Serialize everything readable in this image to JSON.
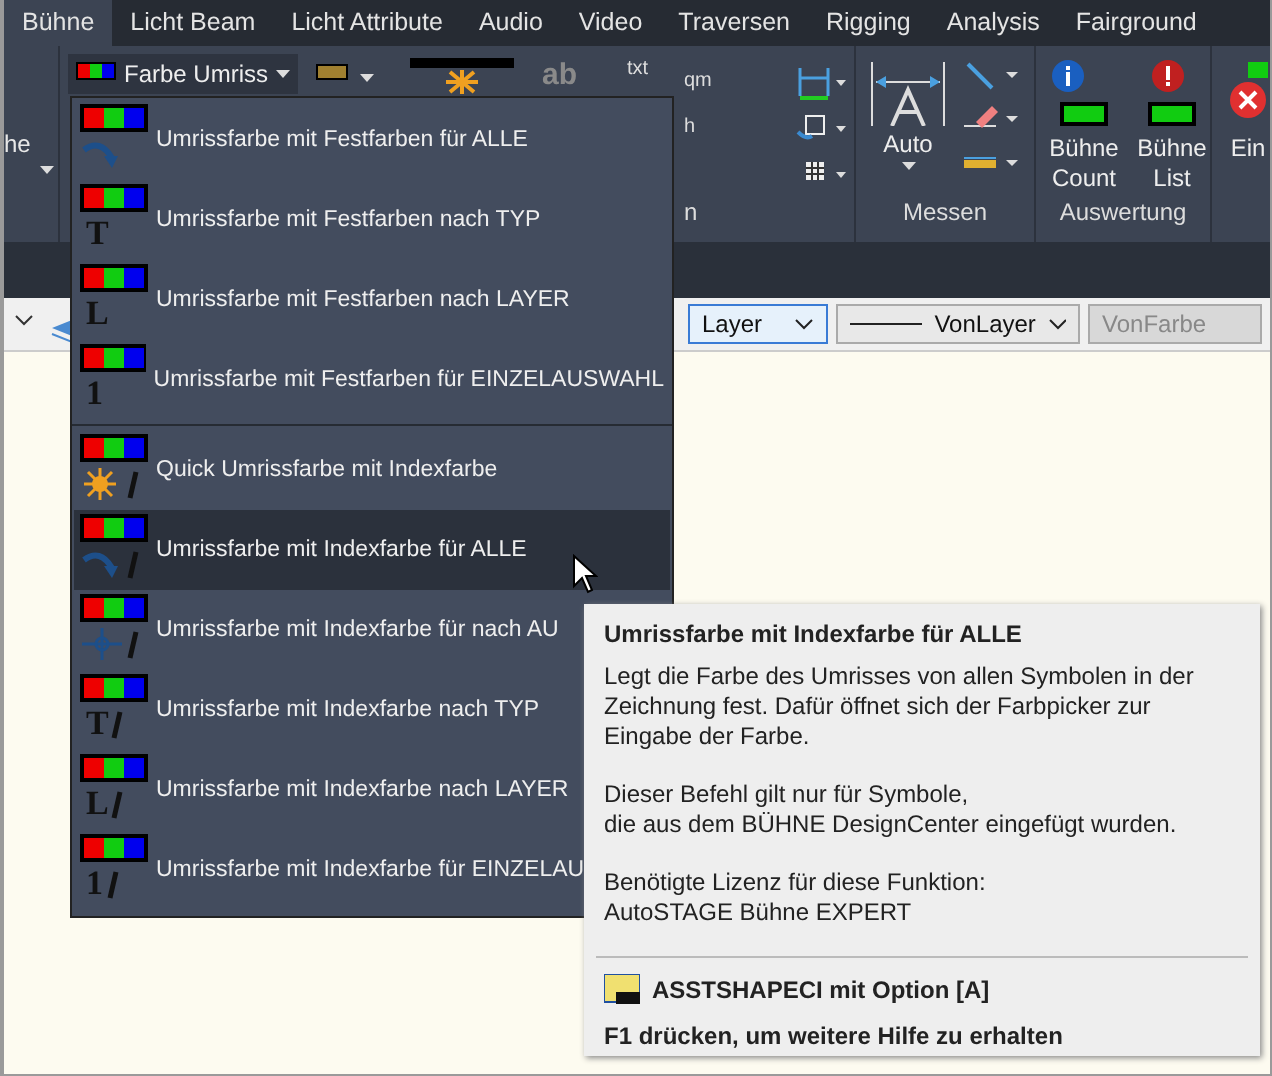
{
  "tabs": [
    {
      "label": "Bühne",
      "selected": true
    },
    {
      "label": "Licht Beam",
      "selected": false
    },
    {
      "label": "Licht Attribute",
      "selected": false
    },
    {
      "label": "Audio",
      "selected": false
    },
    {
      "label": "Video",
      "selected": false
    },
    {
      "label": "Traversen",
      "selected": false
    },
    {
      "label": "Rigging",
      "selected": false
    },
    {
      "label": "Analysis",
      "selected": false
    },
    {
      "label": "Fairground",
      "selected": false
    }
  ],
  "ribbon": {
    "cut_label": "he",
    "split_button": "Farbe Umriss",
    "icon_texts": [
      "ab",
      "txt",
      "qm",
      "h"
    ],
    "panel_labels": [
      "n",
      "Messen",
      "Auswertung"
    ],
    "auto_button": "Auto",
    "count_button": "Bühne Count",
    "list_button": "Bühne List",
    "cut_button": "Ein"
  },
  "toolbar": {
    "layer_combo": "Layer",
    "linetype_combo": "VonLayer",
    "color_combo": {
      "value": "VonFarbe",
      "disabled": true
    }
  },
  "menu": {
    "items": [
      {
        "label": "Umrissfarbe mit Festfarben für ALLE",
        "kind": "arrow",
        "index": false,
        "selected": false
      },
      {
        "label": "Umrissfarbe mit Festfarben nach TYP",
        "kind": "letter",
        "glyph": "T",
        "index": false,
        "selected": false
      },
      {
        "label": "Umrissfarbe mit Festfarben nach LAYER",
        "kind": "letter",
        "glyph": "L",
        "index": false,
        "selected": false
      },
      {
        "label": "Umrissfarbe mit Festfarben für EINZELAUSWAHL",
        "kind": "letter",
        "glyph": "1",
        "index": false,
        "selected": false,
        "separator_after": true
      },
      {
        "label": "Quick Umrissfarbe mit Indexfarbe",
        "kind": "sun",
        "index": true,
        "selected": false
      },
      {
        "label": "Umrissfarbe mit Indexfarbe für ALLE",
        "kind": "arrow",
        "index": true,
        "selected": true
      },
      {
        "label": "Umrissfarbe mit Indexfarbe für nach AU",
        "kind": "cross",
        "index": true,
        "selected": false
      },
      {
        "label": "Umrissfarbe mit Indexfarbe nach TYP",
        "kind": "letter",
        "glyph": "T",
        "index": true,
        "selected": false
      },
      {
        "label": "Umrissfarbe mit Indexfarbe nach LAYER",
        "kind": "letter",
        "glyph": "L",
        "index": true,
        "selected": false
      },
      {
        "label": "Umrissfarbe mit Indexfarbe für EINZELAU",
        "kind": "letter",
        "glyph": "1",
        "index": true,
        "selected": false
      }
    ]
  },
  "tooltip": {
    "title": "Umrissfarbe mit Indexfarbe für ALLE",
    "paragraphs": [
      [
        "Legt die Farbe des Umrisses von allen Symbolen in der Zeichnung fest. Dafür öffnet sich der Farbpicker zur Eingabe der Farbe."
      ],
      [
        "Dieser Befehl gilt nur für Symbole,",
        "die aus dem BÜHNE DesignCenter eingefügt wurden."
      ],
      [
        "Benötigte Lizenz für diese Funktion:",
        "AutoSTAGE Bühne EXPERT"
      ]
    ],
    "command": "ASSTSHAPECI mit Option [A]",
    "help": "F1 drücken, um weitere Hilfe zu erhalten"
  }
}
